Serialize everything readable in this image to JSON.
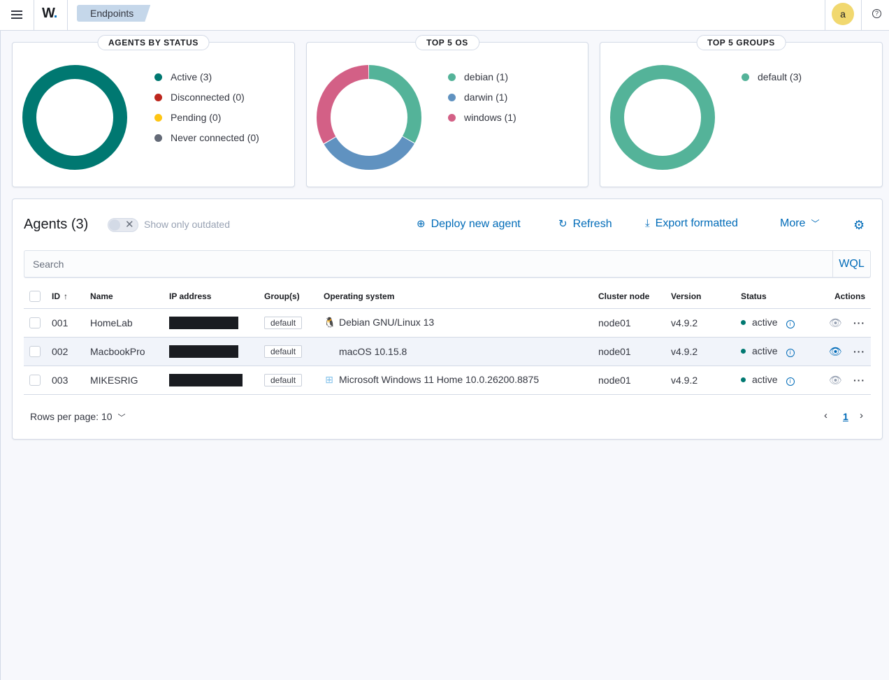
{
  "header": {
    "logo": "W",
    "logo_dot": ".",
    "breadcrumb": "Endpoints",
    "avatar_initial": "a",
    "help": "?"
  },
  "panels": {
    "status": {
      "title": "AGENTS BY STATUS",
      "items": [
        {
          "label": "Active (3)",
          "color": "#007871",
          "value": 3
        },
        {
          "label": "Disconnected (0)",
          "color": "#bd271e",
          "value": 0
        },
        {
          "label": "Pending (0)",
          "color": "#fec514",
          "value": 0
        },
        {
          "label": "Never connected (0)",
          "color": "#646a77",
          "value": 0
        }
      ]
    },
    "os": {
      "title": "TOP 5 OS",
      "items": [
        {
          "label": "debian (1)",
          "color": "#54b399",
          "value": 1
        },
        {
          "label": "darwin (1)",
          "color": "#6092c0",
          "value": 1
        },
        {
          "label": "windows (1)",
          "color": "#d36086",
          "value": 1
        }
      ]
    },
    "groups": {
      "title": "TOP 5 GROUPS",
      "items": [
        {
          "label": "default (3)",
          "color": "#54b399",
          "value": 3
        }
      ]
    }
  },
  "agents": {
    "title": "Agents (3)",
    "toggle_label": "Show only outdated",
    "actions": {
      "deploy": "Deploy new agent",
      "refresh": "Refresh",
      "export": "Export formatted",
      "more": "More"
    },
    "search_placeholder": "Search",
    "wql": "WQL",
    "columns": [
      "ID",
      "Name",
      "IP address",
      "Group(s)",
      "Operating system",
      "Cluster node",
      "Version",
      "Status",
      "Actions"
    ],
    "rows": [
      {
        "id": "001",
        "name": "HomeLab",
        "group": "default",
        "os": "Debian GNU/Linux 13",
        "os_icon": "linux-icon",
        "node": "node01",
        "version": "v4.9.2",
        "status": "active"
      },
      {
        "id": "002",
        "name": "MacbookPro",
        "group": "default",
        "os": "macOS 10.15.8",
        "os_icon": "apple-icon",
        "node": "node01",
        "version": "v4.9.2",
        "status": "active"
      },
      {
        "id": "003",
        "name": "MIKESRIG",
        "group": "default",
        "os": "Microsoft Windows 11 Home 10.0.26200.8875",
        "os_icon": "windows-icon",
        "node": "node01",
        "version": "v4.9.2",
        "status": "active"
      }
    ],
    "rows_per_page": "Rows per page: 10",
    "current_page": "1"
  }
}
